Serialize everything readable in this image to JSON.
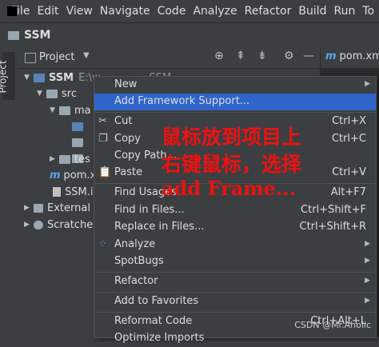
{
  "menubar": {
    "items": [
      "File",
      "Edit",
      "View",
      "Navigate",
      "Code",
      "Analyze",
      "Refactor",
      "Build",
      "Run",
      "To"
    ]
  },
  "navbar": {
    "title": "SSM"
  },
  "left_strip": {
    "project_tab": "Project"
  },
  "toolwindow": {
    "title": "Project",
    "dropdown": "▼",
    "icons": {
      "locate": "⊕",
      "expand": "⇞",
      "collapse": "⇟",
      "settings": "⚙",
      "hide": "—"
    }
  },
  "editor": {
    "tab_icon": "m",
    "tab_label": "pom.xm"
  },
  "tree": {
    "root": {
      "name": "SSM",
      "path": "E:\\w...............SSM"
    },
    "src": "src",
    "main": "ma",
    "test": "tes",
    "pom": "pom.x",
    "iml": "SSM.i",
    "external": "External",
    "scratches": "Scratche"
  },
  "context_menu": {
    "items": {
      "new": {
        "label": "New"
      },
      "add_framework": {
        "label": "Add Framework Support..."
      },
      "cut": {
        "label": "Cut",
        "shortcut": "Ctrl+X",
        "icon": "✂"
      },
      "copy": {
        "label": "Copy",
        "shortcut": "Ctrl+C",
        "icon": "❐"
      },
      "copy_path": {
        "label": "Copy Path..."
      },
      "paste": {
        "label": "Paste",
        "shortcut": "Ctrl+V",
        "icon": "📋"
      },
      "find_usages": {
        "label": "Find Usages",
        "shortcut": "Alt+F7"
      },
      "find_in_files": {
        "label": "Find in Files...",
        "shortcut": "Ctrl+Shift+F"
      },
      "replace_in_files": {
        "label": "Replace in Files...",
        "shortcut": "Ctrl+Shift+R"
      },
      "analyze": {
        "label": "Analyze",
        "icon": "⁘"
      },
      "spotbugs": {
        "label": "SpotBugs"
      },
      "refactor": {
        "label": "Refactor"
      },
      "add_favorites": {
        "label": "Add to Favorites"
      },
      "reformat": {
        "label": "Reformat Code",
        "shortcut": "Ctrl+Alt+L"
      },
      "optimize": {
        "label": "Optimize Imports"
      }
    }
  },
  "overlay": {
    "line1": "鼠标放到项目上",
    "line2": "右键鼠标，选择",
    "line3": "add Frame..."
  },
  "watermark": "CSDN @Mr.Aholic",
  "colors": {
    "selection": "#2f65ca",
    "annotation": "#ee1111",
    "background": "#3c3f41"
  }
}
